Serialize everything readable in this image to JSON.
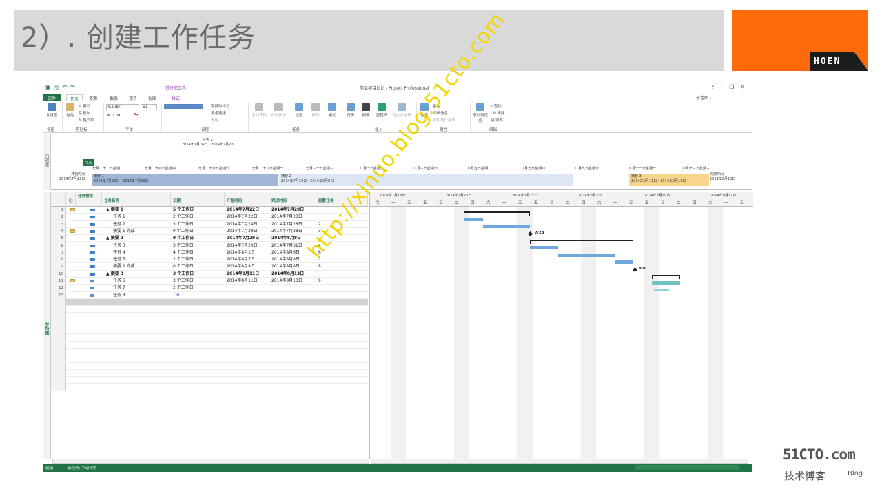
{
  "slide": {
    "title": "2）. 创建工作任务",
    "logo_text": "HOEN",
    "blog_logo": "51CTO.com",
    "blog_sub": "技术博客",
    "blog_sub2": "Blog",
    "watermark": "http://xinuo.blog.51cto.com"
  },
  "app": {
    "window_title": "简单项目计划 - Project Professional",
    "contextual_tab": "甘特图工具",
    "user": "于连图 -",
    "tabs": [
      "文件",
      "任务",
      "资源",
      "报表",
      "项目",
      "视图",
      "格式"
    ],
    "ribbon": {
      "view_btn": "甘特图",
      "paste_btn": "粘贴",
      "cut": "剪切",
      "copy": "复制",
      "format_painter": "格式刷",
      "font_name": "Calibri",
      "font_size": "11",
      "mark_on_track": "跟踪时标记",
      "respect_links": "考虑链接",
      "inactivate": "停用",
      "manual_schedule": "手动安排",
      "auto_schedule": "自动安排",
      "inspect": "检查",
      "move": "移动",
      "mode": "模式",
      "task_btn": "任务",
      "summary_btn": "摘要",
      "milestone_btn": "里程碑",
      "deliverable_btn": "可交付结果",
      "info_btn": "信息",
      "notes": "备注",
      "details": "详细信息",
      "add_timeline": "添加到日程表",
      "scroll_to_task": "滚动到任务",
      "find": "查找",
      "clear": "清除",
      "fill": "填充",
      "group_labels": {
        "view": "视图",
        "clipboard": "剪贴板",
        "font": "字体",
        "schedule": "日程",
        "tasks": "任务",
        "insert": "插入",
        "properties": "属性",
        "editing": "编辑"
      }
    },
    "timeline": {
      "side_label": "日程表",
      "today": "今天",
      "callout": "任务 2\n2014年7月24日 - 2014年7月28",
      "start_label": "开始时间\n2014年7月22日",
      "finish_label": "完成时间\n2014年8月13日",
      "dates": [
        "七月二十二日星期二",
        "七月二十四日星期四",
        "七月二十六日星期六",
        "七月二十八日星期一",
        "七月三十日星期三",
        "八月一日星期五",
        "八月三日星期日",
        "八月五日星期二",
        "八月七日星期四",
        "八月九日星期六",
        "八月十一日星期一",
        "八月十三日星期三"
      ],
      "segments": [
        {
          "name": "摘要 1",
          "range": "2014年7月22日 - 2014年7月28日"
        },
        {
          "name": "摘要 2",
          "range": "2014年7月29日 - 2014年8月8日"
        },
        {
          "name": "摘要 3",
          "range": "2014年8月11日 - 2014年8月13日"
        }
      ]
    },
    "grid": {
      "side_label": "甘特图",
      "headers": [
        "任务模式",
        "任务名称",
        "工期",
        "开始时间",
        "完成时间",
        "前置任务"
      ],
      "rows": [
        {
          "id": "1",
          "name": "▲ 摘要 1",
          "dur": "5 个工作日",
          "start": "2014年7月22日",
          "finish": "2014年7月28日",
          "pred": "",
          "summary": true
        },
        {
          "id": "2",
          "name": "任务 1",
          "dur": "2 个工作日",
          "start": "2014年7月22日",
          "finish": "2014年7月23日",
          "pred": ""
        },
        {
          "id": "3",
          "name": "任务 2",
          "dur": "3 个工作日",
          "start": "2014年7月24日",
          "finish": "2014年7月28日",
          "pred": "2"
        },
        {
          "id": "4",
          "name": "摘要 1 完成",
          "dur": "0 个工作日",
          "start": "2014年7月28日",
          "finish": "2014年7月28日",
          "pred": "3"
        },
        {
          "id": "5",
          "name": "▲ 摘要 2",
          "dur": "9 个工作日",
          "start": "2014年7月29日",
          "finish": "2014年8月8日",
          "pred": "",
          "summary": true
        },
        {
          "id": "6",
          "name": "任务 3",
          "dur": "3 个工作日",
          "start": "2014年7月29日",
          "finish": "2014年7月31日",
          "pred": "4"
        },
        {
          "id": "7",
          "name": "任务 4",
          "dur": "4 个工作日",
          "start": "2014年8月1日",
          "finish": "2014年8月6日",
          "pred": "6"
        },
        {
          "id": "8",
          "name": "任务 5",
          "dur": "2 个工作日",
          "start": "2014年8月7日",
          "finish": "2014年8月8日",
          "pred": "7"
        },
        {
          "id": "9",
          "name": "摘要 2 完成",
          "dur": "0 个工作日",
          "start": "2014年8月8日",
          "finish": "2014年8月8日",
          "pred": "8"
        },
        {
          "id": "10",
          "name": "▲ 摘要 3",
          "dur": "3 个工作日",
          "start": "2014年8月11日",
          "finish": "2014年8月13日",
          "pred": "",
          "summary": true
        },
        {
          "id": "11",
          "name": "任务 6",
          "dur": "3 个工作日",
          "start": "2014年8月11日",
          "finish": "2014年8月13日",
          "pred": "9"
        },
        {
          "id": "12",
          "name": "任务 7",
          "dur": "2 个工作日",
          "start": "",
          "finish": "",
          "pred": ""
        },
        {
          "id": "13",
          "name": "任务 8",
          "dur": "TBD",
          "start": "",
          "finish": "",
          "pred": ""
        }
      ]
    },
    "gantt": {
      "weeks": [
        "2014年7月13日",
        "2014年7月20日",
        "2014年7月27日",
        "2014年8月3日",
        "2014年8月10日",
        "2014年8月17日"
      ],
      "day_letters": [
        "六",
        "一",
        "三",
        "五",
        "日",
        "二",
        "四"
      ],
      "milestone_labels": [
        "7/28",
        "8/8"
      ]
    },
    "status": {
      "ready": "就绪",
      "new_tasks": "新任务: 手动计划"
    }
  }
}
